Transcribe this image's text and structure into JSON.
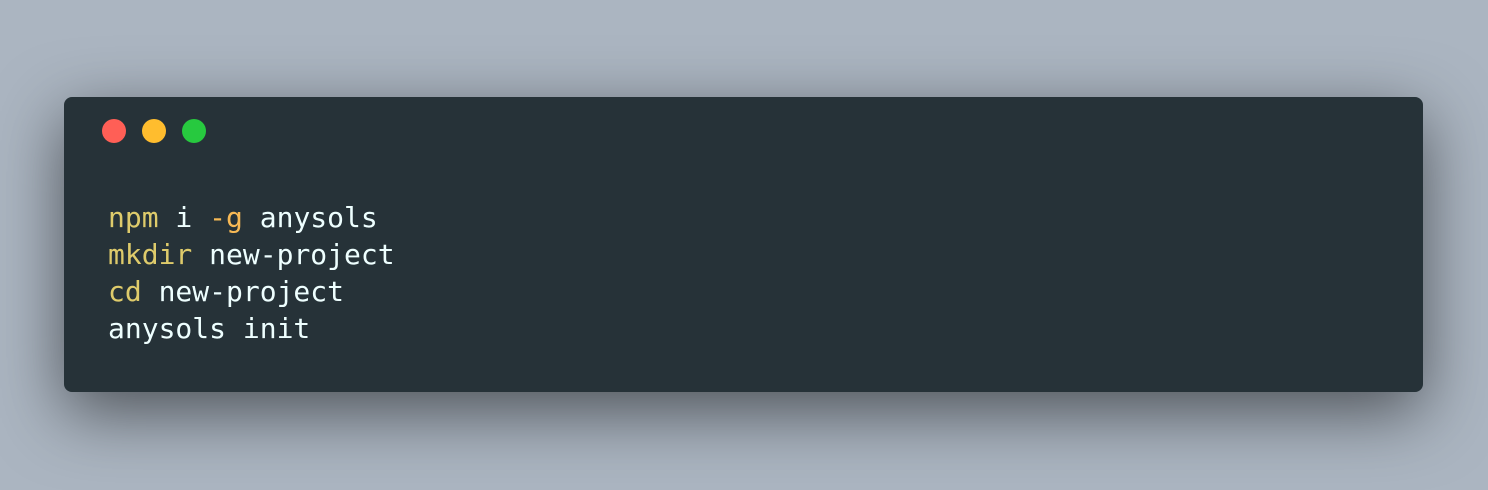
{
  "window": {
    "controls": [
      "close",
      "minimize",
      "maximize"
    ],
    "colors": {
      "background": "#263238",
      "keyword": "#decb6b",
      "flag": "#f7b955",
      "text": "#eeffff"
    }
  },
  "code": {
    "lines": [
      {
        "cmd": "npm",
        "rest1": " i ",
        "flag": "-g",
        "rest2": " anysols"
      },
      {
        "cmd": "mkdir",
        "rest1": " new-project"
      },
      {
        "cmd": "cd",
        "rest1": " new-project"
      },
      {
        "text": "anysols init"
      }
    ]
  }
}
